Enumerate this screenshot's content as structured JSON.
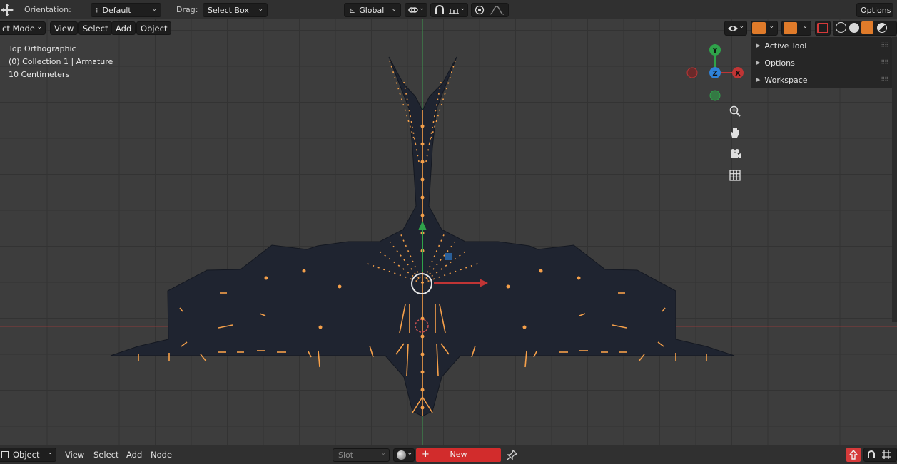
{
  "topbar": {
    "orientation_label": "Orientation:",
    "orientation_value": "Default",
    "drag_label": "Drag:",
    "drag_value": "Select Box",
    "transform_space": "Global",
    "options_label": "Options"
  },
  "header": {
    "mode": "ct Mode",
    "menus": [
      "View",
      "Select",
      "Add",
      "Object"
    ]
  },
  "overlay": {
    "view_name": "Top Orthographic",
    "collection": "(0) Collection 1 | Armature",
    "scale": "10 Centimeters"
  },
  "gizmo": {
    "y": "Y",
    "z": "Z",
    "x": "X"
  },
  "npanel": {
    "items": [
      "Active Tool",
      "Options",
      "Workspace"
    ]
  },
  "bottombar": {
    "editor_mode": "Object",
    "menus": [
      "View",
      "Select",
      "Add",
      "Node"
    ],
    "slot": "Slot",
    "new_label": "New"
  },
  "colors": {
    "bone": "#f5a04a",
    "axis_x": "#c03535",
    "axis_y": "#2fa34a",
    "gizmo_z": "#2f82d9",
    "new_button": "#d22c2c"
  }
}
